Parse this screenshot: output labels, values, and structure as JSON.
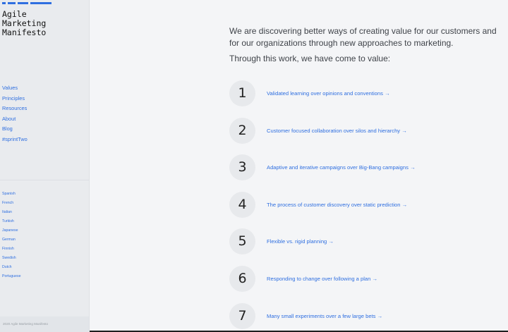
{
  "sidebar": {
    "logo_lines": [
      "Agile",
      "Marketing",
      "Manifesto"
    ],
    "nav": [
      "Values",
      "Principles",
      "Resources",
      "About",
      "Blog",
      "#sprintTwo"
    ],
    "languages": [
      "Spanish",
      "French",
      "Italian",
      "Turkish",
      "Japanese",
      "German",
      "Finnish",
      "Swedish",
      "Dutch",
      "Portuguese"
    ],
    "copyright": "2020 Agile Marketing Manifesto"
  },
  "main": {
    "intro": "We are discovering better ways of creating value for our customers and for our organizations through new approaches to marketing.",
    "intro2": "Through this work, we have come to value:",
    "values": [
      {
        "number": "1",
        "text": "Validated learning over opinions and conventions"
      },
      {
        "number": "2",
        "text": "Customer focused collaboration over silos and hierarchy"
      },
      {
        "number": "3",
        "text": "Adaptive and iterative campaigns over Big-Bang campaigns"
      },
      {
        "number": "4",
        "text": "The process of customer discovery over static prediction"
      },
      {
        "number": "5",
        "text": "Flexible vs. rigid planning"
      },
      {
        "number": "6",
        "text": "Responding to change over following a plan"
      },
      {
        "number": "7",
        "text": "Many small experiments over a few large bets"
      }
    ],
    "arrow": "→"
  },
  "colors": {
    "accent": "#2f6fe0",
    "sidebar_bg": "#e9ebee",
    "page_bg": "#f4f5f7",
    "circle_bg": "#e7e9ec"
  }
}
